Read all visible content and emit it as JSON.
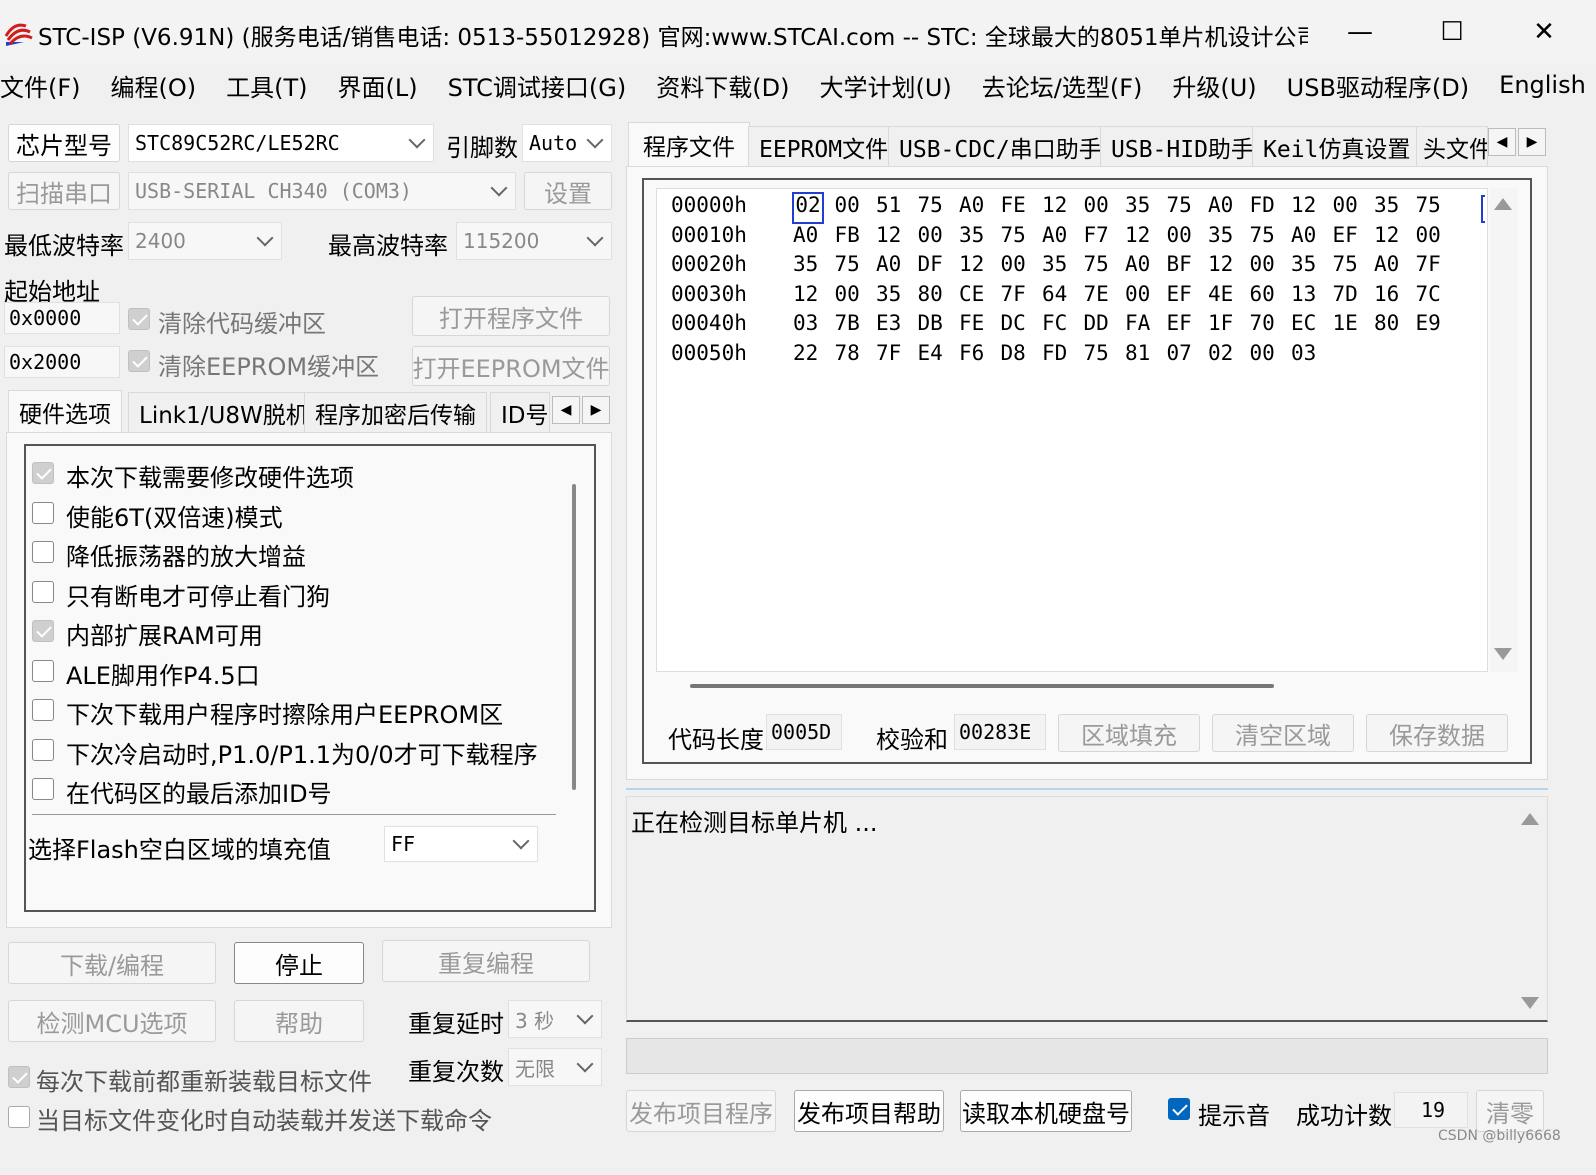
{
  "window": {
    "title": "STC-ISP (V6.91N) (服务电话/销售电话: 0513-55012928) 官网:www.STCAI.com  -- STC: 全球最大的8051单片机设计公司 (...",
    "minimize": "—",
    "maximize": "☐",
    "close": "✕"
  },
  "menu": [
    "文件(F)",
    "编程(O)",
    "工具(T)",
    "界面(L)",
    "STC调试接口(G)",
    "资料下载(D)",
    "大学计划(U)",
    "去论坛/选型(F)",
    "升级(U)",
    "USB驱动程序(D)",
    "English"
  ],
  "left": {
    "chip_button": "芯片型号",
    "chip_value": "STC89C52RC/LE52RC",
    "pin_label": "引脚数",
    "pin_value": "Auto",
    "scan_button": "扫描串口",
    "port_value": "USB-SERIAL CH340 (COM3)",
    "settings_button": "设置",
    "min_baud_label": "最低波特率",
    "min_baud_value": "2400",
    "max_baud_label": "最高波特率",
    "max_baud_value": "115200",
    "start_addr_label": "起始地址",
    "code_addr": "0x0000",
    "clear_code_label": "清除代码缓冲区",
    "open_program_button": "打开程序文件",
    "eeprom_addr": "0x2000",
    "clear_eeprom_label": "清除EEPROM缓冲区",
    "open_eeprom_button": "打开EEPROM文件",
    "tabs": [
      "硬件选项",
      "Link1/U8W脱机",
      "程序加密后传输",
      "ID号"
    ],
    "options": [
      {
        "label": "本次下载需要修改硬件选项",
        "checked": true
      },
      {
        "label": "使能6T(双倍速)模式",
        "checked": false
      },
      {
        "label": "降低振荡器的放大增益",
        "checked": false
      },
      {
        "label": "只有断电才可停止看门狗",
        "checked": false
      },
      {
        "label": "内部扩展RAM可用",
        "checked": true
      },
      {
        "label": "ALE脚用作P4.5口",
        "checked": false
      },
      {
        "label": "下次下载用户程序时擦除用户EEPROM区",
        "checked": false
      },
      {
        "label": "下次冷启动时,P1.0/P1.1为0/0才可下载程序",
        "checked": false
      },
      {
        "label": "在代码区的最后添加ID号",
        "checked": false
      }
    ],
    "fill_label": "选择Flash空白区域的填充值",
    "fill_value": "FF",
    "download_button": "下载/编程",
    "stop_button": "停止",
    "reprogram_button": "重复编程",
    "detect_button": "检测MCU选项",
    "help_button": "帮助",
    "repeat_delay_label": "重复延时",
    "repeat_delay_value": "3 秒",
    "repeat_count_label": "重复次数",
    "repeat_count_value": "无限",
    "reload_label": "每次下载前都重新装载目标文件",
    "auto_load_label": "当目标文件变化时自动装载并发送下载命令"
  },
  "right": {
    "tabs": [
      "程序文件",
      "EEPROM文件",
      "USB-CDC/串口助手",
      "USB-HID助手",
      "Keil仿真设置",
      "头文件"
    ],
    "hex_rows": [
      {
        "addr": "00000h",
        "bytes": [
          "02",
          "00",
          "51",
          "75",
          "A0",
          "FE",
          "12",
          "00",
          "35",
          "75",
          "A0",
          "FD",
          "12",
          "00",
          "35",
          "75"
        ]
      },
      {
        "addr": "00010h",
        "bytes": [
          "A0",
          "FB",
          "12",
          "00",
          "35",
          "75",
          "A0",
          "F7",
          "12",
          "00",
          "35",
          "75",
          "A0",
          "EF",
          "12",
          "00"
        ]
      },
      {
        "addr": "00020h",
        "bytes": [
          "35",
          "75",
          "A0",
          "DF",
          "12",
          "00",
          "35",
          "75",
          "A0",
          "BF",
          "12",
          "00",
          "35",
          "75",
          "A0",
          "7F"
        ]
      },
      {
        "addr": "00030h",
        "bytes": [
          "12",
          "00",
          "35",
          "80",
          "CE",
          "7F",
          "64",
          "7E",
          "00",
          "EF",
          "4E",
          "60",
          "13",
          "7D",
          "16",
          "7C"
        ]
      },
      {
        "addr": "00040h",
        "bytes": [
          "03",
          "7B",
          "E3",
          "DB",
          "FE",
          "DC",
          "FC",
          "DD",
          "FA",
          "EF",
          "1F",
          "70",
          "EC",
          "1E",
          "80",
          "E9"
        ]
      },
      {
        "addr": "00050h",
        "bytes": [
          "22",
          "78",
          "7F",
          "E4",
          "F6",
          "D8",
          "FD",
          "75",
          "81",
          "07",
          "02",
          "00",
          "03"
        ]
      }
    ],
    "code_len_label": "代码长度",
    "code_len_value": "0005D",
    "checksum_label": "校验和",
    "checksum_value": "00283E",
    "fill_area_button": "区域填充",
    "clear_area_button": "清空区域",
    "save_data_button": "保存数据",
    "log_text": "正在检测目标单片机 ...",
    "publish_program_button": "发布项目程序",
    "publish_help_button": "发布项目帮助",
    "read_disk_button": "读取本机硬盘号",
    "sound_label": "提示音",
    "success_count_label": "成功计数",
    "success_count_value": "19",
    "clear_button": "清零"
  },
  "watermark": "CSDN @billy6668",
  "colors": {
    "accent": "#0067c0",
    "selection_border": "#1f3fd0"
  }
}
